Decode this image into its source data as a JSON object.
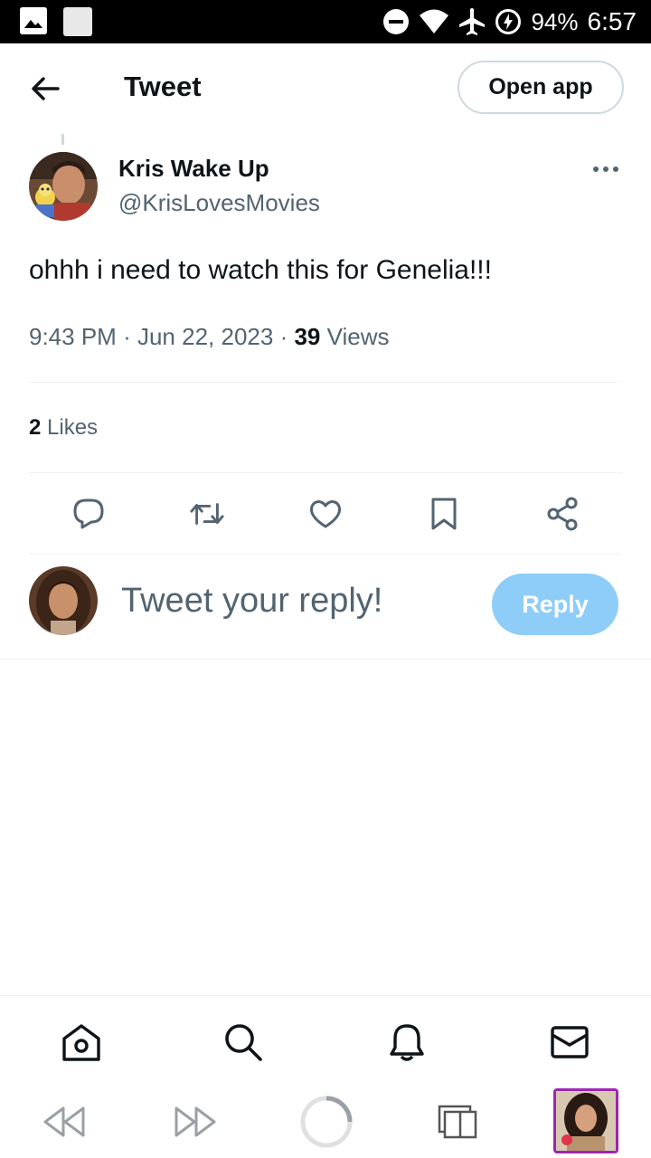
{
  "status_bar": {
    "battery": "94%",
    "time": "6:57",
    "icons": [
      "gallery-icon",
      "square-icon",
      "do-not-disturb-icon",
      "wifi-icon",
      "airplane-icon",
      "battery-charging-icon"
    ]
  },
  "header": {
    "title": "Tweet",
    "open_app_label": "Open app"
  },
  "tweet": {
    "display_name": "Kris Wake Up",
    "handle": "@KrisLovesMovies",
    "text": "ohhh i need to watch this for Genelia!!!",
    "time": "9:43 PM",
    "separator": "·",
    "date": "Jun 22, 2023",
    "views_count": "39",
    "views_label": "Views",
    "likes_count": "2",
    "likes_label": "Likes"
  },
  "actions": [
    "reply-icon",
    "retweet-icon",
    "like-icon",
    "bookmark-icon",
    "share-icon"
  ],
  "reply": {
    "placeholder": "Tweet your reply!",
    "button_label": "Reply"
  },
  "bottom_nav": [
    "home-icon",
    "search-icon",
    "notifications-icon",
    "messages-icon"
  ],
  "browser_bar": [
    "back-icon",
    "forward-icon",
    "loading-icon",
    "tabs-icon",
    "tab-thumbnail"
  ],
  "colors": {
    "text_primary": "#0f1419",
    "text_secondary": "#536471",
    "divider": "#eff3f4",
    "reply_button": "#8ecdf8",
    "thumbnail_border": "#9c27b0"
  }
}
